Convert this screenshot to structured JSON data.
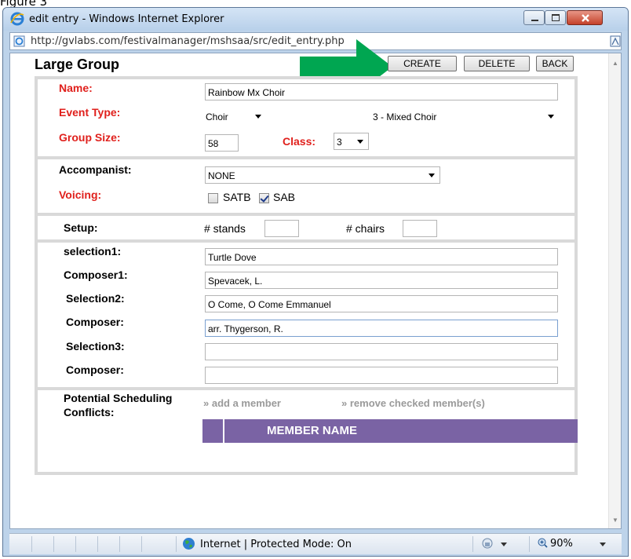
{
  "figure_label": "Figure 3",
  "window": {
    "title": "edit entry - Windows Internet Explorer",
    "url": "http://gvlabs.com/festivalmanager/mshsaa/src/edit_entry.php"
  },
  "page": {
    "title": "Large Group",
    "buttons": {
      "create": "CREATE",
      "delete": "DELETE",
      "back": "BACK"
    }
  },
  "form": {
    "name_label": "Name:",
    "name_value": "Rainbow Mx Choir",
    "event_type_label": "Event Type:",
    "event_type_value": "Choir",
    "event_subtype_value": "3 - Mixed Choir",
    "group_size_label": "Group Size:",
    "group_size_value": "58",
    "class_label": "Class:",
    "class_value": "3",
    "accompanist_label": "Accompanist:",
    "accompanist_value": "NONE",
    "voicing_label": "Voicing:",
    "voicing_options": [
      {
        "label": "SATB",
        "checked": false
      },
      {
        "label": "SAB",
        "checked": true
      }
    ],
    "setup_label": "Setup:",
    "stands_label": "# stands",
    "stands_value": "",
    "chairs_label": "# chairs",
    "chairs_value": "",
    "selection1_label": "selection1:",
    "selection1_value": "Turtle Dove",
    "composer1_label": "Composer1:",
    "composer1_value": "Spevacek, L.",
    "selection2_label": "Selection2:",
    "selection2_value": "O Come, O Come Emmanuel",
    "composer2_label": "Composer:",
    "composer2_value": "arr.  Thygerson, R.",
    "selection3_label": "Selection3:",
    "selection3_value": "",
    "composer3_label": "Composer:",
    "composer3_value": "",
    "conflicts_label": "Potential Scheduling Conflicts:",
    "add_member_link": "» add a member",
    "remove_member_link": "» remove checked member(s)",
    "member_header": "MEMBER NAME"
  },
  "status": {
    "zone_text": "Internet | Protected Mode: On",
    "zoom": "90%"
  },
  "colors": {
    "required_label": "#e0201c",
    "member_header_bg": "#7a63a4",
    "arrow": "#00a651",
    "close_button": "#c4412a"
  }
}
